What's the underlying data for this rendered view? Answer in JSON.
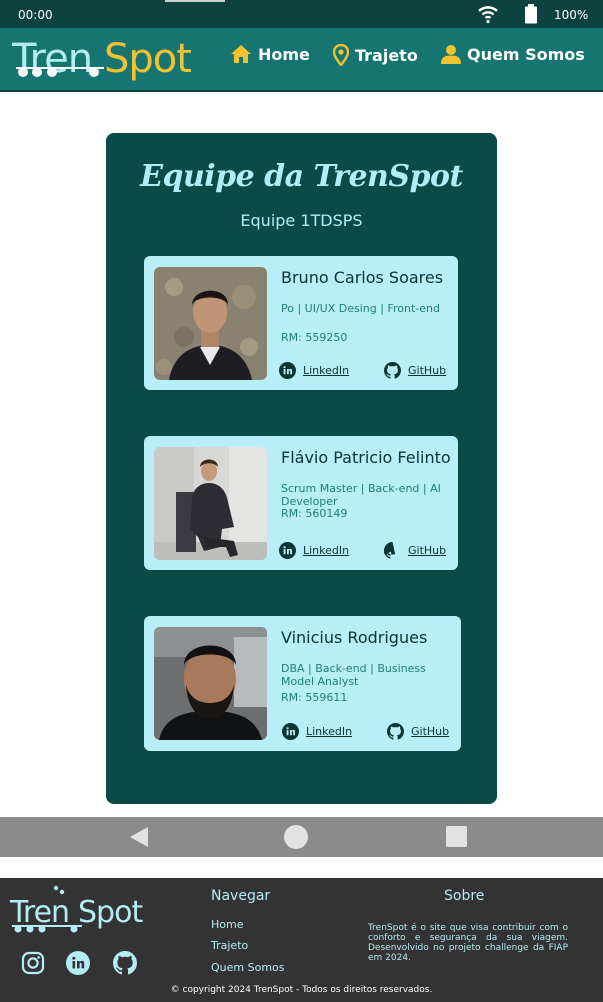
{
  "status_bar": {
    "time": "00:00",
    "battery": "100%"
  },
  "header": {
    "brand": {
      "part1": "Tren",
      "part2": "Spot"
    },
    "nav": [
      {
        "label": "Home",
        "icon": "home-icon"
      },
      {
        "label": "Trajeto",
        "icon": "map-pin-icon"
      },
      {
        "label": "Quem Somos",
        "icon": "user-icon"
      }
    ]
  },
  "team": {
    "title": "Equipe da TrenSpot",
    "subtitle": "Equipe 1TDSPS",
    "members": [
      {
        "name": "Bruno Carlos Soares",
        "role": "Po | UI/UX Desing | Front-end",
        "rm": "RM: 559250",
        "linkedin": "LinkedIn",
        "github": "GitHub"
      },
      {
        "name": "Flávio Patricio Felinto",
        "role": "Scrum Master | Back-end | AI Developer",
        "rm": "RM: 560149",
        "linkedin": "LinkedIn",
        "github": "GitHub"
      },
      {
        "name": "Vinicius Rodrigues",
        "role": "DBA | Back-end | Business Model Analyst",
        "rm": "RM: 559611",
        "linkedin": "LinkedIn",
        "github": "GitHub"
      }
    ]
  },
  "footer": {
    "brand": {
      "part1": "Tren",
      "part2": "Spot"
    },
    "social": [
      "instagram-icon",
      "linkedin-icon",
      "github-icon"
    ],
    "nav_title": "Navegar",
    "nav_items": [
      "Home",
      "Trajeto",
      "Quem Somos"
    ],
    "about_title": "Sobre",
    "about_text": "TrenSpot é o site que visa contribuir com o conforto e segurança da sua viagem. Desenvolvido no projeto challenge da FIAP em 2024.",
    "copyright": "© copyright 2024 TrenSpot - Todos os direitos reservados."
  },
  "colors": {
    "header_bg": "#167570",
    "dark_teal": "#0c4a47",
    "card_bg": "#b7eef7",
    "accent_yellow": "#f2c230",
    "light_cyan": "#b4ecf5",
    "footer_bg": "#333333"
  }
}
